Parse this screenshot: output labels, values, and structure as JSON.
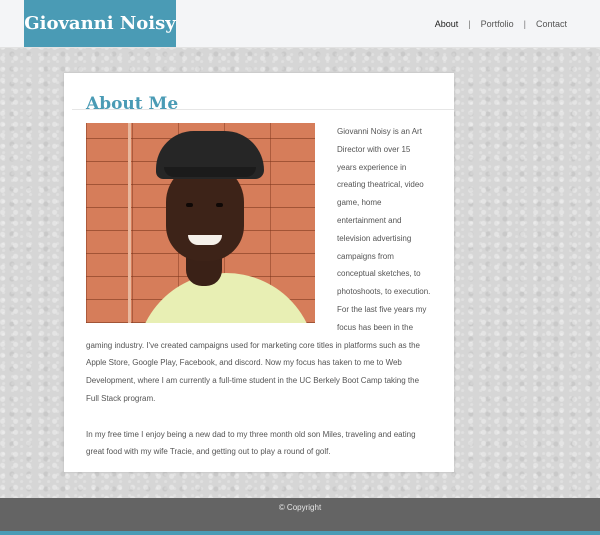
{
  "header": {
    "brand": "Giovanni Noisy",
    "nav": [
      {
        "label": "About",
        "active": true
      },
      {
        "label": "Portfolio",
        "active": false
      },
      {
        "label": "Contact",
        "active": false
      }
    ],
    "separator": "|"
  },
  "about": {
    "title": "About Me",
    "paragraph1": "Giovanni Noisy is an Art Director with over 15 years experience in creating theatrical, video game, home entertainment and television advertising campaigns from conceptual sketches, to photoshoots, to execution. For the last five years my focus has been in the gaming industry. I've created campaigns used for marketing core titles in platforms such as the Apple Store, Google Play, Facebook, and discord. Now my focus has taken to me to Web Development, where I am currently a full-time student in the UC Berkely Boot Camp taking the Full Stack program.",
    "paragraph2": "In my free time I enjoy being a new dad to my three month old son Miles, traveling and eating great food with my wife Tracie, and getting out to play a round of golf."
  },
  "footer": {
    "copyright": "© Copyright"
  },
  "colors": {
    "accent": "#4a9bb5",
    "footer": "#646464"
  }
}
